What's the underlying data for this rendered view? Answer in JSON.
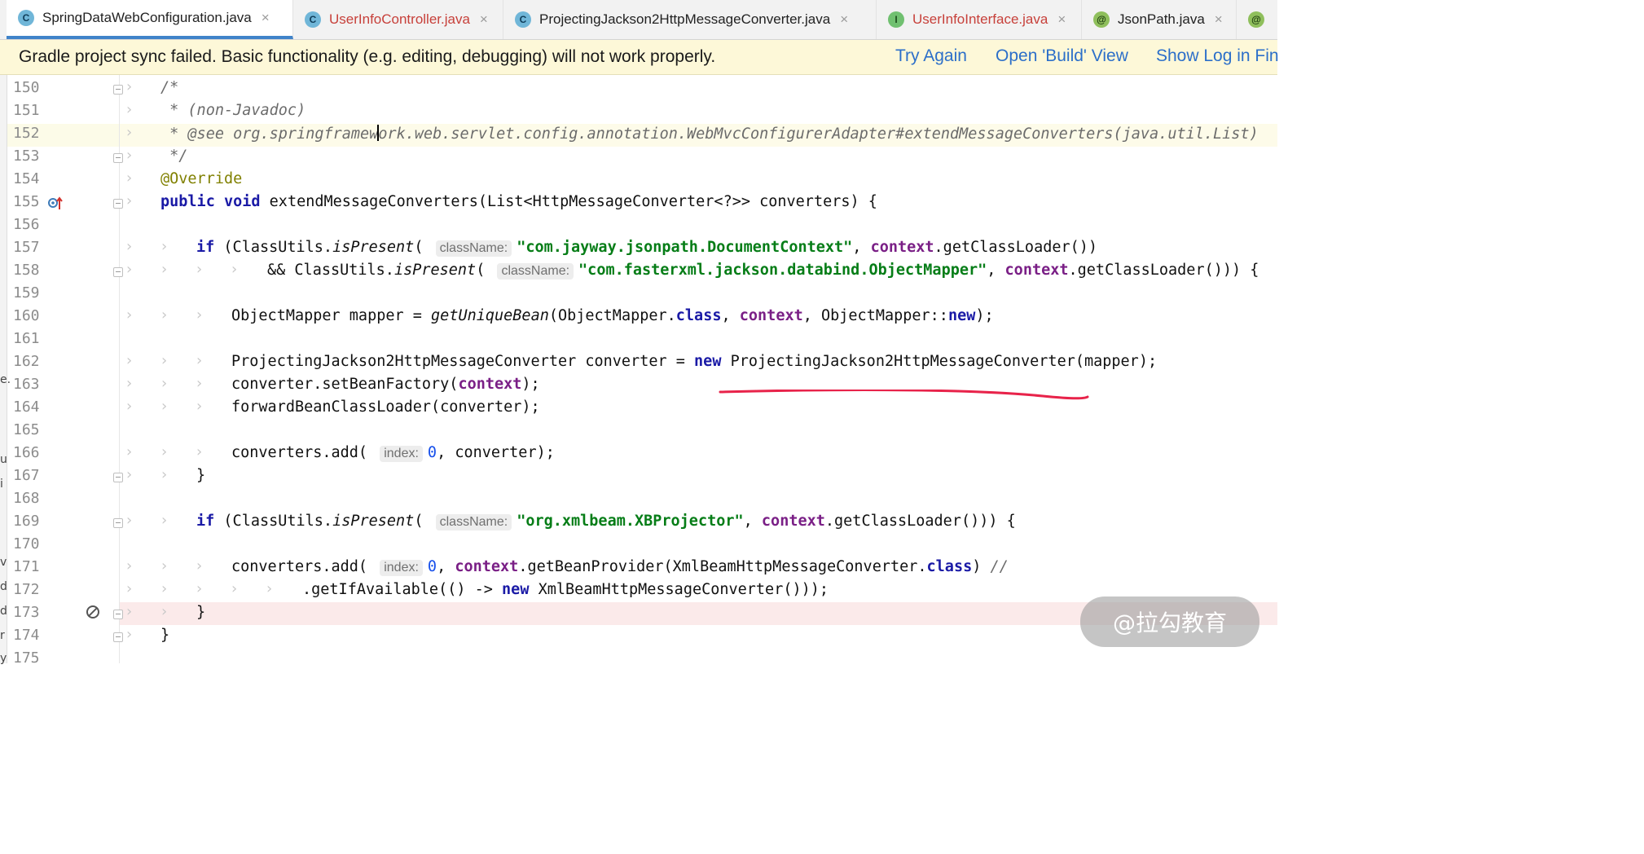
{
  "tabs": [
    {
      "label": "SpringDataWebConfiguration.java",
      "icon": "class-icon",
      "glyph": "C",
      "active": true,
      "error": false
    },
    {
      "label": "UserInfoController.java",
      "icon": "class-icon",
      "glyph": "C",
      "active": false,
      "error": true
    },
    {
      "label": "ProjectingJackson2HttpMessageConverter.java",
      "icon": "class-icon",
      "glyph": "C",
      "active": false,
      "error": false
    },
    {
      "label": "UserInfoInterface.java",
      "icon": "interface-icon",
      "glyph": "I",
      "active": false,
      "error": true
    },
    {
      "label": "JsonPath.java",
      "icon": "annotation-icon",
      "glyph": "@",
      "active": false,
      "error": false
    }
  ],
  "tab_overflow_glyph": "@",
  "banner": {
    "message": "Gradle project sync failed. Basic functionality (e.g. editing, debugging) will not work properly.",
    "try_again": "Try Again",
    "open_build": "Open 'Build' View",
    "show_log": "Show Log in Fin"
  },
  "editor": {
    "current_line": 152,
    "breakpoint_line": 173,
    "lines": [
      {
        "n": "150",
        "t": "/*"
      },
      {
        "n": "151",
        "t": " * (non-Javadoc)"
      },
      {
        "n": "152",
        "t": " * @see org.springframework.web.servlet.config.annotation.WebMvcConfigurerAdapter#extendMessageConverters(java.util.List)"
      },
      {
        "n": "153",
        "t": " */"
      },
      {
        "n": "154",
        "t": "@Override"
      },
      {
        "n": "155",
        "t": "public void extendMessageConverters(List<HttpMessageConverter<?>> converters) {"
      },
      {
        "n": "156",
        "t": ""
      },
      {
        "n": "157",
        "t": "if (ClassUtils.isPresent( className: \"com.jayway.jsonpath.DocumentContext\", context.getClassLoader())"
      },
      {
        "n": "158",
        "t": "&& ClassUtils.isPresent( className: \"com.fasterxml.jackson.databind.ObjectMapper\", context.getClassLoader())) {"
      },
      {
        "n": "159",
        "t": ""
      },
      {
        "n": "160",
        "t": "ObjectMapper mapper = getUniqueBean(ObjectMapper.class, context, ObjectMapper::new);"
      },
      {
        "n": "161",
        "t": ""
      },
      {
        "n": "162",
        "t": "ProjectingJackson2HttpMessageConverter converter = new ProjectingJackson2HttpMessageConverter(mapper);"
      },
      {
        "n": "163",
        "t": "converter.setBeanFactory(context);"
      },
      {
        "n": "164",
        "t": "forwardBeanClassLoader(converter);"
      },
      {
        "n": "165",
        "t": ""
      },
      {
        "n": "166",
        "t": "converters.add( index: 0, converter);"
      },
      {
        "n": "167",
        "t": "}"
      },
      {
        "n": "168",
        "t": ""
      },
      {
        "n": "169",
        "t": "if (ClassUtils.isPresent( className: \"org.xmlbeam.XBProjector\", context.getClassLoader())) {"
      },
      {
        "n": "170",
        "t": ""
      },
      {
        "n": "171",
        "t": "converters.add( index: 0, context.getBeanProvider(XmlBeamHttpMessageConverter.class) //"
      },
      {
        "n": "172",
        "t": ".getIfAvailable(() -> new XmlBeamHttpMessageConverter()));"
      },
      {
        "n": "173",
        "t": "}"
      },
      {
        "n": "174",
        "t": "}"
      },
      {
        "n": "175",
        "t": ""
      }
    ]
  },
  "annotation": {
    "color": "#e8234a"
  },
  "watermark": "@拉勾教育",
  "side_chars": [
    "e.",
    "u",
    "i",
    "v",
    "d",
    "d",
    "r",
    "y"
  ]
}
